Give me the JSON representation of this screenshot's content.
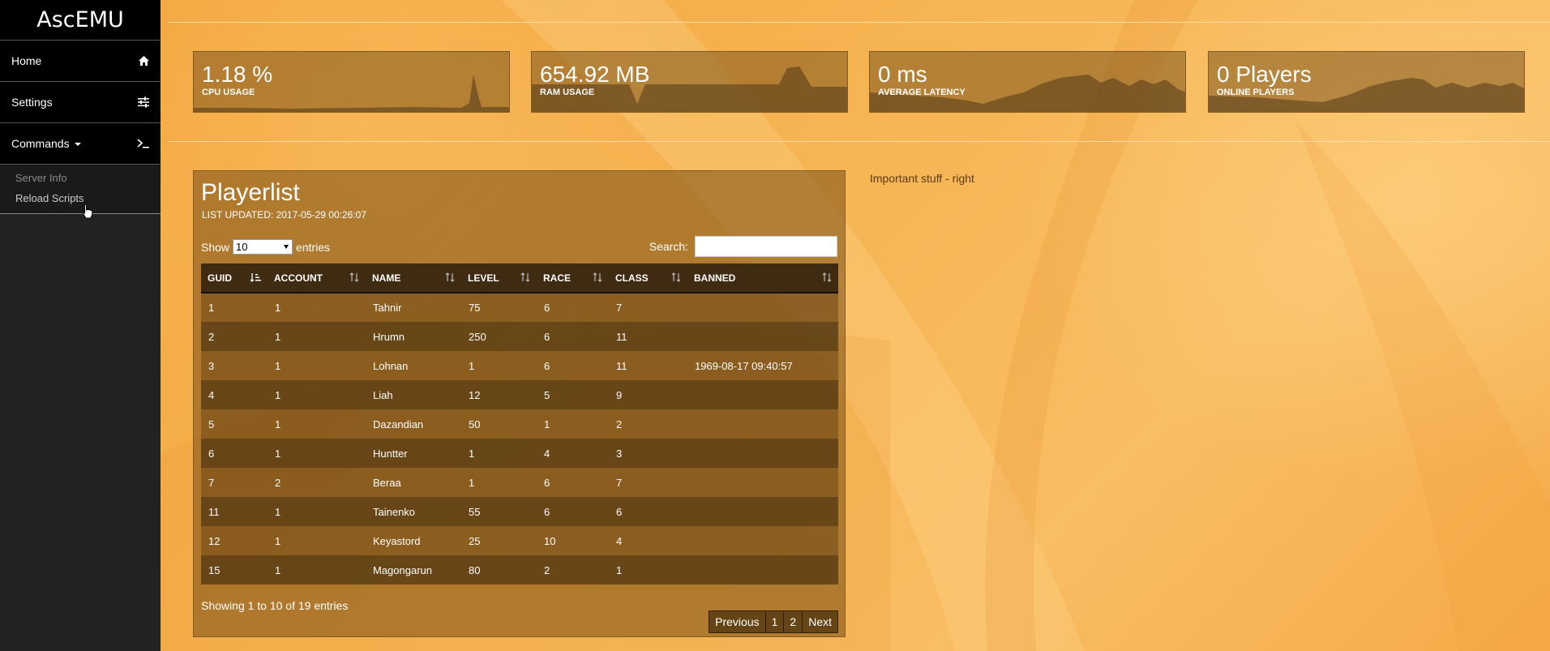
{
  "app": {
    "logo": "AscEMU"
  },
  "sidebar": {
    "items": [
      {
        "label": "Home",
        "icon": "home-icon"
      },
      {
        "label": "Settings",
        "icon": "sliders-icon"
      },
      {
        "label": "Commands",
        "icon": "terminal-icon"
      }
    ],
    "submenu": [
      {
        "label": "Server Info"
      },
      {
        "label": "Reload Scripts"
      }
    ]
  },
  "stats": [
    {
      "value": "1.18 %",
      "label": "CPU USAGE"
    },
    {
      "value": "654.92 MB",
      "label": "RAM USAGE"
    },
    {
      "value": "0 ms",
      "label": "AVERAGE LATENCY"
    },
    {
      "value": "0 Players",
      "label": "ONLINE PLAYERS"
    }
  ],
  "playerlist": {
    "title": "Playerlist",
    "updated": "LIST UPDATED: 2017-05-29 00:26:07",
    "show_label": "Show",
    "show_value": "10",
    "entries_label": "entries",
    "search_label": "Search:",
    "columns": [
      "GUID",
      "ACCOUNT",
      "NAME",
      "LEVEL",
      "RACE",
      "CLASS",
      "BANNED"
    ],
    "rows": [
      [
        "1",
        "1",
        "Tahnir",
        "75",
        "6",
        "7",
        ""
      ],
      [
        "2",
        "1",
        "Hrumn",
        "250",
        "6",
        "11",
        ""
      ],
      [
        "3",
        "1",
        "Lohnan",
        "1",
        "6",
        "11",
        "1969-08-17 09:40:57"
      ],
      [
        "4",
        "1",
        "Liah",
        "12",
        "5",
        "9",
        ""
      ],
      [
        "5",
        "1",
        "Dazandian",
        "50",
        "1",
        "2",
        ""
      ],
      [
        "6",
        "1",
        "Huntter",
        "1",
        "4",
        "3",
        ""
      ],
      [
        "7",
        "2",
        "Beraa",
        "1",
        "6",
        "7",
        ""
      ],
      [
        "11",
        "1",
        "Tainenko",
        "55",
        "6",
        "6",
        ""
      ],
      [
        "12",
        "1",
        "Keyastord",
        "25",
        "10",
        "4",
        ""
      ],
      [
        "15",
        "1",
        "Magongarun",
        "80",
        "2",
        "1",
        ""
      ]
    ],
    "info": "Showing 1 to 10 of 19 entries",
    "pagination": {
      "prev": "Previous",
      "pages": [
        "1",
        "2"
      ],
      "next": "Next"
    }
  },
  "right_panel": {
    "text": "Important stuff - right"
  }
}
